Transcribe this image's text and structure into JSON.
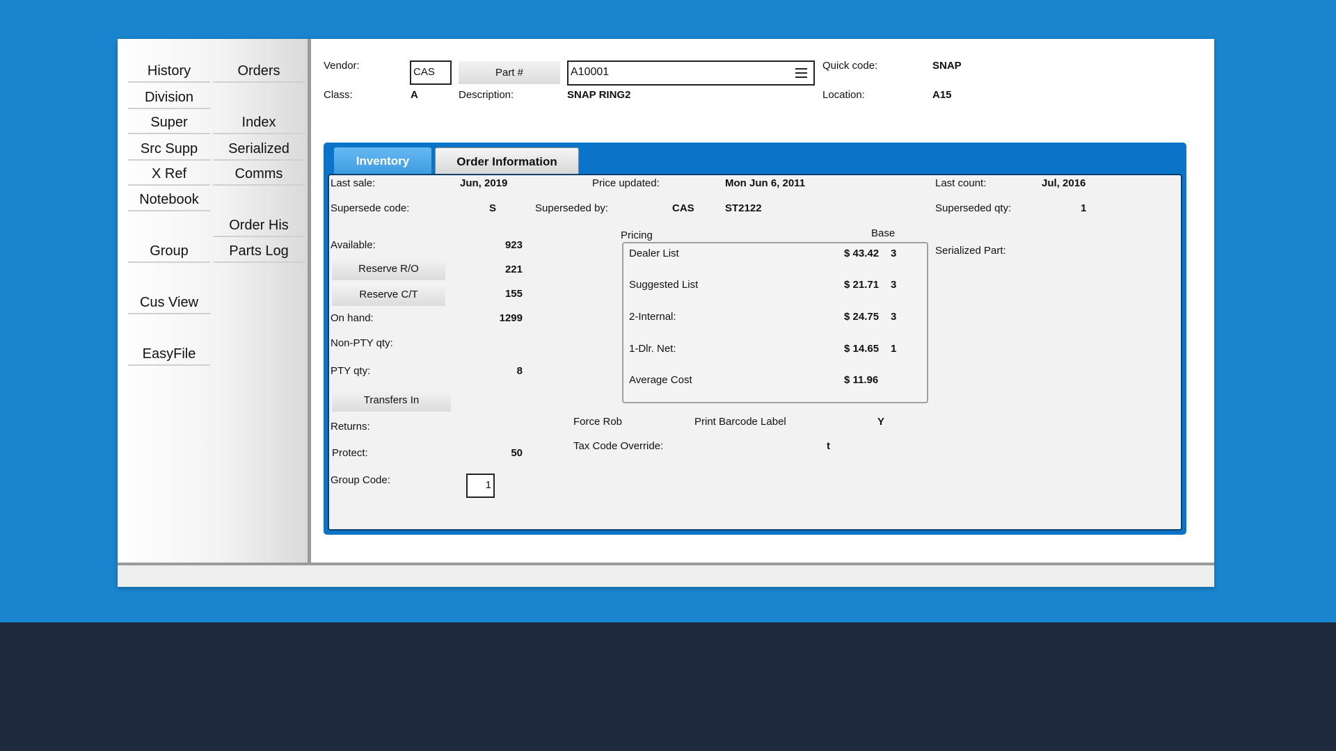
{
  "header": {
    "vendor_label": "Vendor:",
    "vendor_value": "CAS",
    "part_button": "Part #",
    "part_value": "A10001",
    "quick_code_label": "Quick code:",
    "quick_code_value": "SNAP",
    "class_label": "Class:",
    "class_value": "A",
    "description_label": "Description:",
    "description_value": "SNAP RING2",
    "location_label": "Location:",
    "location_value": "A15"
  },
  "sidebar": {
    "left": [
      "History",
      "Division",
      "Super",
      "Src Supp",
      "X Ref",
      "Notebook",
      "Group",
      "Cus View",
      "EasyFile"
    ],
    "right": [
      "Orders",
      "Index",
      "Serialized",
      "Comms",
      "Order His",
      "Parts Log"
    ]
  },
  "tabs": {
    "inventory": "Inventory",
    "order_information": "Order Information"
  },
  "inventory": {
    "last_sale_label": "Last sale:",
    "last_sale_value": "Jun, 2019",
    "price_updated_label": "Price updated:",
    "price_updated_value": "Mon Jun 6, 2011",
    "last_count_label": "Last count:",
    "last_count_value": "Jul, 2016",
    "supersede_code_label": "Supersede code:",
    "supersede_code_value": "S",
    "superseded_by_label": "Superseded by:",
    "superseded_by_vendor": "CAS",
    "superseded_by_part": "ST2122",
    "superseded_qty_label": "Superseded qty:",
    "superseded_qty_value": "1",
    "available_label": "Available:",
    "available_value": "923",
    "reserve_ro_button": "Reserve R/O",
    "reserve_ro_value": "221",
    "reserve_ct_button": "Reserve C/T",
    "reserve_ct_value": "155",
    "on_hand_label": "On hand:",
    "on_hand_value": "1299",
    "non_pty_label": "Non-PTY qty:",
    "pty_label": "PTY qty:",
    "pty_value": "8",
    "transfers_in_button": "Transfers In",
    "returns_label": "Returns:",
    "protect_label": "Protect:",
    "protect_value": "50",
    "group_code_label": "Group Code:",
    "group_code_value": "1",
    "serialized_part_label": "Serialized Part:",
    "force_rob_label": "Force Rob",
    "print_barcode_label": "Print Barcode Label",
    "print_barcode_value": "Y",
    "tax_code_label": "Tax Code Override:",
    "tax_code_value": "t"
  },
  "pricing": {
    "title": "Pricing",
    "base_label": "Base",
    "rows": [
      {
        "label": "Dealer List",
        "price": "$ 43.42",
        "base": "3"
      },
      {
        "label": "Suggested List",
        "price": "$ 21.71",
        "base": "3"
      },
      {
        "label": "2-Internal:",
        "price": "$ 24.75",
        "base": "3"
      },
      {
        "label": "1-Dlr. Net:",
        "price": "$ 14.65",
        "base": "1"
      },
      {
        "label": "Average Cost",
        "price": "$ 11.96",
        "base": ""
      }
    ]
  }
}
